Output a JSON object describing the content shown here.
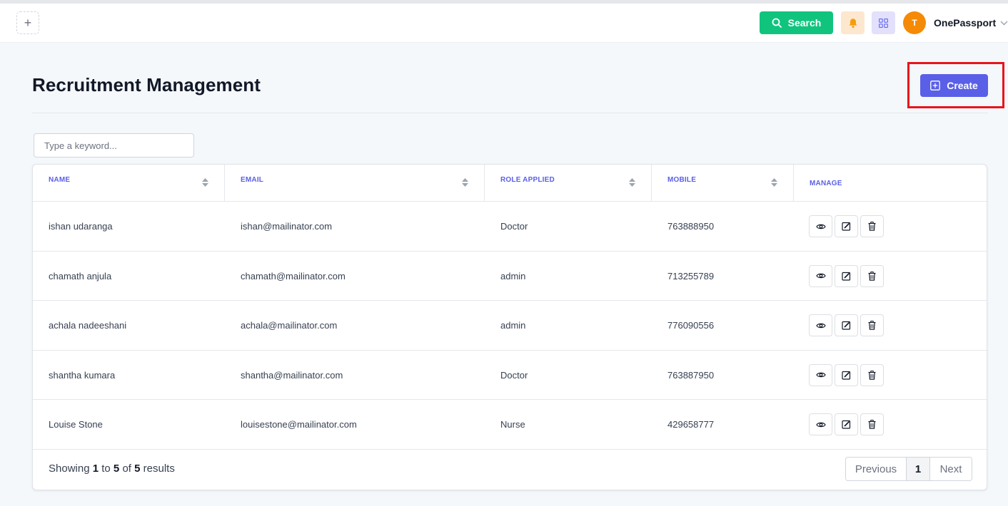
{
  "topbar": {
    "search_label": "Search",
    "avatar_initial": "T",
    "user_name": "OnePassport",
    "colors": {
      "search": "#10c47e",
      "bell_bg": "#fde7cf",
      "bell": "#f59e0b",
      "grid_bg": "#e2e0fb",
      "grid": "#6366f1",
      "avatar": "#f58a07"
    }
  },
  "page": {
    "title": "Recruitment Management",
    "create_label": "Create",
    "accent": "#5a5fe8",
    "highlight": "#e8141b"
  },
  "search": {
    "placeholder": "Type a keyword..."
  },
  "table": {
    "columns": [
      "NAME",
      "EMAIL",
      "ROLE APPLIED",
      "MOBILE",
      "MANAGE"
    ],
    "rows": [
      {
        "name": "ishan udaranga",
        "email": "ishan@mailinator.com",
        "role": "Doctor",
        "mobile": "763888950"
      },
      {
        "name": "chamath anjula",
        "email": "chamath@mailinator.com",
        "role": "admin",
        "mobile": "713255789"
      },
      {
        "name": "achala nadeeshani",
        "email": "achala@mailinator.com",
        "role": "admin",
        "mobile": "776090556"
      },
      {
        "name": "shantha kumara",
        "email": "shantha@mailinator.com",
        "role": "Doctor",
        "mobile": "763887950"
      },
      {
        "name": "Louise Stone",
        "email": "louisestone@mailinator.com",
        "role": "Nurse",
        "mobile": "429658777"
      }
    ],
    "row_action_icons": [
      "eye-icon",
      "edit-icon",
      "trash-icon"
    ]
  },
  "footer": {
    "showing": "Showing",
    "from": "1",
    "to_word": "to",
    "to": "5",
    "of_word": "of",
    "total": "5",
    "results": "results"
  },
  "pagination": {
    "previous": "Previous",
    "current": "1",
    "next": "Next"
  }
}
